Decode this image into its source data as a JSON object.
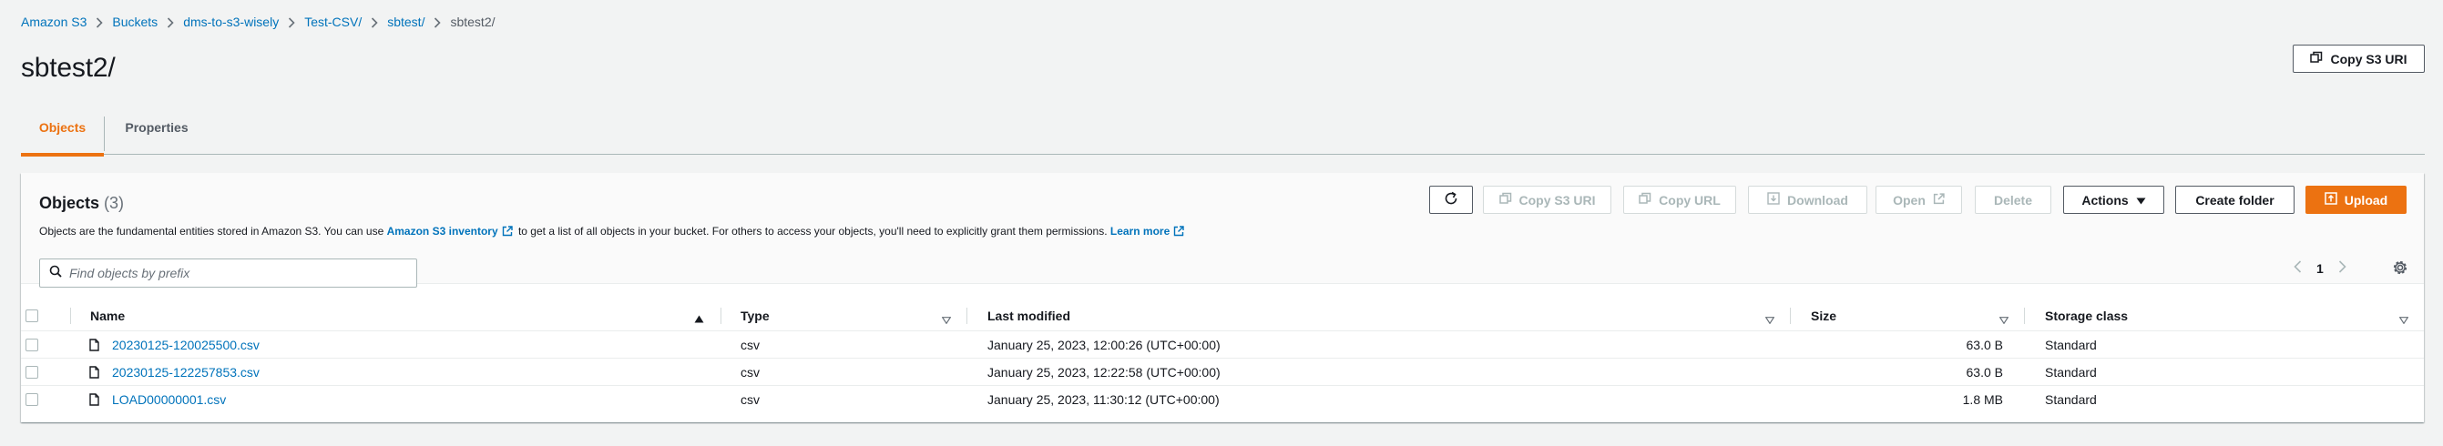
{
  "breadcrumb": [
    "Amazon S3",
    "Buckets",
    "dms-to-s3-wisely",
    "Test-CSV/",
    "sbtest/",
    "sbtest2/"
  ],
  "page_title": "sbtest2/",
  "copy_s3_uri_label": "Copy S3 URI",
  "tabs": [
    {
      "label": "Objects",
      "active": true
    },
    {
      "label": "Properties",
      "active": false
    }
  ],
  "panel": {
    "title": "Objects",
    "count": "(3)",
    "desc_before": "Objects are the fundamental entities stored in Amazon S3. You can use",
    "inventory_link": "Amazon S3 inventory",
    "desc_after": "to get a list of all objects in your bucket. For others to access your objects, you'll need to explicitly grant them permissions.",
    "learn_more": "Learn more"
  },
  "toolbar": {
    "copy_s3_uri": "Copy S3 URI",
    "copy_url": "Copy URL",
    "download": "Download",
    "open": "Open",
    "delete": "Delete",
    "actions": "Actions",
    "create_folder": "Create folder",
    "upload": "Upload"
  },
  "search": {
    "placeholder": "Find objects by prefix",
    "value": ""
  },
  "pagination": {
    "current_page": "1"
  },
  "table": {
    "headers": {
      "name": "Name",
      "type": "Type",
      "last_modified": "Last modified",
      "size": "Size",
      "storage_class": "Storage class"
    },
    "rows": [
      {
        "name": "20230125-120025500.csv",
        "type": "csv",
        "last_modified": "January 25, 2023, 12:00:26 (UTC+00:00)",
        "size": "63.0 B",
        "storage_class": "Standard"
      },
      {
        "name": "20230125-122257853.csv",
        "type": "csv",
        "last_modified": "January 25, 2023, 12:22:58 (UTC+00:00)",
        "size": "63.0 B",
        "storage_class": "Standard"
      },
      {
        "name": "LOAD00000001.csv",
        "type": "csv",
        "last_modified": "January 25, 2023, 11:30:12 (UTC+00:00)",
        "size": "1.8 MB",
        "storage_class": "Standard"
      }
    ]
  },
  "colors": {
    "accent": "#ec7211",
    "link": "#0073bb",
    "background": "#f2f3f3"
  }
}
